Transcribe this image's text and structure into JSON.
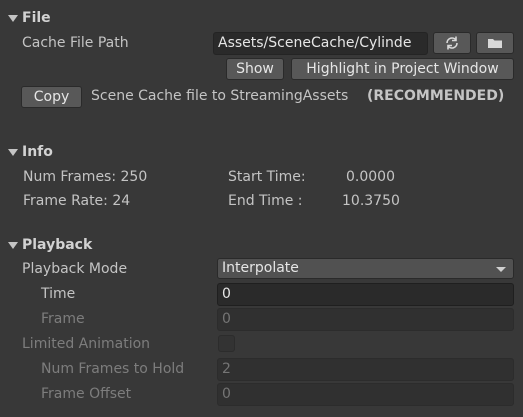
{
  "file": {
    "header": "File",
    "cache_file_path_label": "Cache File Path",
    "cache_file_path_value": "Assets/SceneCache/Cylinde",
    "refresh_icon": "refresh-icon",
    "folder_icon": "folder-icon",
    "show_button": "Show",
    "highlight_button": "Highlight in Project Window",
    "copy_button": "Copy",
    "copy_description": "Scene Cache file to StreamingAssets",
    "recommended": "(RECOMMENDED)"
  },
  "info": {
    "header": "Info",
    "num_frames": "Num Frames: 250",
    "frame_rate": "Frame Rate: 24",
    "start_time_label": "Start Time:",
    "start_time_value": "0.0000",
    "end_time_label": "End Time :",
    "end_time_value": "10.3750"
  },
  "playback": {
    "header": "Playback",
    "mode_label": "Playback Mode",
    "mode_value": "Interpolate",
    "time_label": "Time",
    "time_value": "0",
    "frame_label": "Frame",
    "frame_value": "0",
    "limited_animation_label": "Limited Animation",
    "limited_animation_checked": false,
    "num_frames_to_hold_label": "Num Frames to Hold",
    "num_frames_to_hold_value": "2",
    "frame_offset_label": "Frame Offset",
    "frame_offset_value": "0"
  }
}
